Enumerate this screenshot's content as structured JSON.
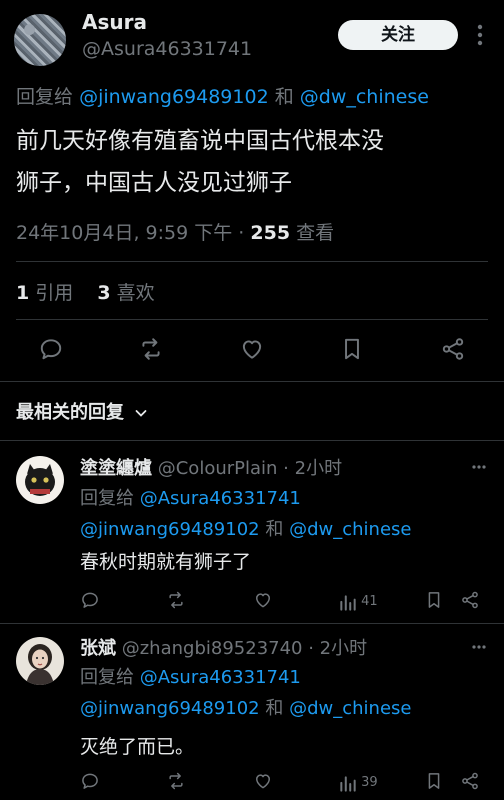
{
  "post": {
    "author_name": "Asura",
    "author_handle": "@Asura46331741",
    "follow_label": "关注",
    "reply_to_prefix": "回复给",
    "reply_to_1": "@jinwang69489102",
    "reply_to_and": "和",
    "reply_to_2": "@dw_chinese",
    "text_line1": "前几天好像有殖畜说中国古代根本没",
    "text_line2": "狮子，中国古人没见过狮子",
    "timestamp": "24年10月4日, 9:59 下午",
    "separator": "·",
    "views_count": "255",
    "views_label": "查看",
    "quotes_count": "1",
    "quotes_label": "引用",
    "likes_count": "3",
    "likes_label": "喜欢"
  },
  "replies_header": {
    "label": "最相关的回复"
  },
  "replies": [
    {
      "name": "塗塗纏爐",
      "handle": "@ColourPlain",
      "time": "· 2小时",
      "reply_prefix": "回复给",
      "reply_to_1": "@Asura46331741",
      "reply_to_2": "@jinwang69489102",
      "and": "和",
      "reply_to_3": "@dw_chinese",
      "text": "春秋时期就有狮子了",
      "views": "41"
    },
    {
      "name": "张斌",
      "handle": "@zhangbi89523740",
      "time": "· 2小时",
      "reply_prefix": "回复给",
      "reply_to_1": "@Asura46331741",
      "reply_to_2": "@jinwang69489102",
      "and": "和",
      "reply_to_3": "@dw_chinese",
      "text": "灭绝了而已。",
      "views": "39"
    }
  ],
  "colors": {
    "background": "#000000",
    "text": "#e7e9ea",
    "muted": "#71767b",
    "link": "#1d9bf0",
    "divider": "#2f3336",
    "follow_button_bg": "#eff3f4"
  }
}
